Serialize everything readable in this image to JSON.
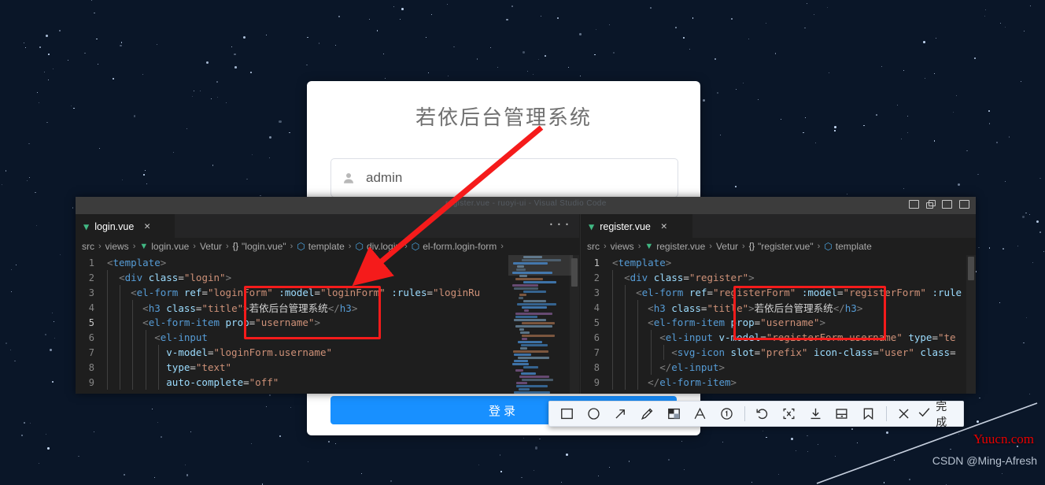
{
  "background": {
    "name": "starry-night-sky"
  },
  "login_page": {
    "title": "若依后台管理系统",
    "username_value": "admin",
    "username_icon": "user-icon",
    "login_button_label": "登录"
  },
  "editor_window": {
    "title_strip_text": "register.vue - ruoyi-ui - Visual Studio Code",
    "window_buttons": [
      "minimize",
      "restore",
      "maximize",
      "close"
    ],
    "tab_overflow_label": "···",
    "panes": [
      {
        "tab": {
          "label": "login.vue",
          "icon": "vue-icon",
          "close_icon": "close-icon"
        },
        "breadcrumb": [
          {
            "text": "src",
            "icon": ""
          },
          {
            "text": "views",
            "icon": ""
          },
          {
            "text": "login.vue",
            "icon": "vue-icon"
          },
          {
            "text": "Vetur",
            "icon": ""
          },
          {
            "text": "\"login.vue\"",
            "icon": "braces-icon"
          },
          {
            "text": "template",
            "icon": "cube-icon"
          },
          {
            "text": "div.login",
            "icon": "cube-icon"
          },
          {
            "text": "el-form.login-form",
            "icon": "cube-icon"
          }
        ],
        "lines": [
          {
            "no": "1",
            "indent": 0,
            "text": "<template>"
          },
          {
            "no": "2",
            "indent": 1,
            "text": "<div class=\"login\">"
          },
          {
            "no": "3",
            "indent": 2,
            "text": "<el-form ref=\"loginForm\" :model=\"loginForm\" :rules=\"loginRu"
          },
          {
            "no": "4",
            "indent": 3,
            "text": "<h3 class=\"title\">若依后台管理系统</h3>"
          },
          {
            "no": "5",
            "indent": 3,
            "text": "<el-form-item prop=\"username\">"
          },
          {
            "no": "6",
            "indent": 4,
            "text": "<el-input"
          },
          {
            "no": "7",
            "indent": 5,
            "text": "v-model=\"loginForm.username\""
          },
          {
            "no": "8",
            "indent": 5,
            "text": "type=\"text\""
          },
          {
            "no": "9",
            "indent": 5,
            "text": "auto-complete=\"off\""
          }
        ],
        "active_line": "5"
      },
      {
        "tab": {
          "label": "register.vue",
          "icon": "vue-icon",
          "close_icon": "close-icon"
        },
        "breadcrumb": [
          {
            "text": "src",
            "icon": ""
          },
          {
            "text": "views",
            "icon": ""
          },
          {
            "text": "register.vue",
            "icon": "vue-icon"
          },
          {
            "text": "Vetur",
            "icon": ""
          },
          {
            "text": "\"register.vue\"",
            "icon": "braces-icon"
          },
          {
            "text": "template",
            "icon": "cube-icon"
          }
        ],
        "lines": [
          {
            "no": "1",
            "indent": 0,
            "text": "<template>"
          },
          {
            "no": "2",
            "indent": 1,
            "text": "<div class=\"register\">"
          },
          {
            "no": "3",
            "indent": 2,
            "text": "<el-form ref=\"registerForm\" :model=\"registerForm\" :rule"
          },
          {
            "no": "4",
            "indent": 3,
            "text": "<h3 class=\"title\">若依后台管理系统</h3>"
          },
          {
            "no": "5",
            "indent": 3,
            "text": "<el-form-item prop=\"username\">"
          },
          {
            "no": "6",
            "indent": 4,
            "text": "<el-input v-model=\"registerForm.username\" type=\"te"
          },
          {
            "no": "7",
            "indent": 5,
            "text": "<svg-icon slot=\"prefix\" icon-class=\"user\" class="
          },
          {
            "no": "8",
            "indent": 4,
            "text": "</el-input>"
          },
          {
            "no": "9",
            "indent": 3,
            "text": "</el-form-item>"
          }
        ],
        "active_line": "1"
      }
    ]
  },
  "annotations": {
    "highlight_color": "#f51b1b",
    "boxes": [
      {
        "name": "left-highlight-box"
      },
      {
        "name": "right-highlight-box"
      }
    ],
    "arrow": {
      "name": "red-arrow-pointer"
    }
  },
  "annot_toolbar": {
    "tools": [
      {
        "name": "rectangle-tool",
        "glyph": "square"
      },
      {
        "name": "ellipse-tool",
        "glyph": "circle"
      },
      {
        "name": "arrow-tool",
        "glyph": "arrow"
      },
      {
        "name": "pen-tool",
        "glyph": "pencil"
      },
      {
        "name": "mosaic-tool",
        "glyph": "mosaic"
      },
      {
        "name": "text-tool",
        "glyph": "A"
      },
      {
        "name": "serial-number-tool",
        "glyph": "circled-1"
      },
      {
        "name": "undo-tool",
        "glyph": "undo"
      },
      {
        "name": "ocr-tool",
        "glyph": "ocr"
      },
      {
        "name": "download-tool",
        "glyph": "download"
      },
      {
        "name": "save-tool",
        "glyph": "save"
      },
      {
        "name": "pin-tool",
        "glyph": "bookmark"
      },
      {
        "name": "cancel-tool",
        "glyph": "x"
      }
    ],
    "done_label": "完成",
    "done_icon": "check-icon"
  },
  "watermarks": {
    "site": "Yuucn.com",
    "author": "CSDN @Ming-Afresh"
  }
}
